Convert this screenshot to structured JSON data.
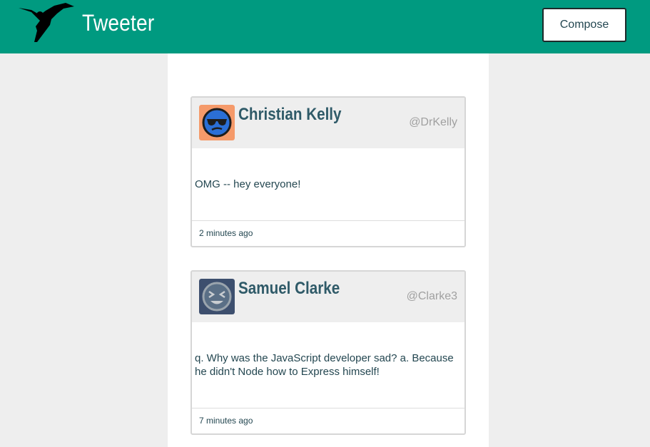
{
  "header": {
    "brand": "Tweeter",
    "compose_label": "Compose",
    "background_color": "#009a80"
  },
  "tweets": [
    {
      "name": "Christian Kelly",
      "handle": "@DrKelly",
      "body": "OMG -- hey everyone!",
      "time": "2 minutes ago",
      "avatar_bg": "#f59a6a",
      "avatar_icon": "sunglasses-face-icon"
    },
    {
      "name": "Samuel Clarke",
      "handle": "@Clarke3",
      "body": "q. Why was the JavaScript developer sad? a. Because he didn't Node how to Express himself!",
      "time": "7 minutes ago",
      "avatar_bg": "#3d4f6e",
      "avatar_icon": "laughing-face-icon"
    }
  ]
}
